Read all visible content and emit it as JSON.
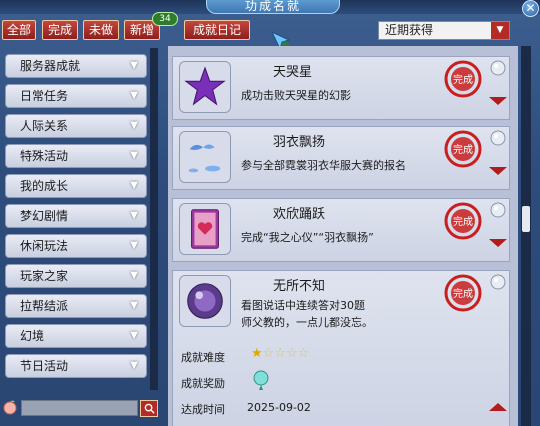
{
  "window": {
    "title": "功成名就",
    "close_glyph": "✕"
  },
  "filter_tabs": [
    {
      "label": "全部"
    },
    {
      "label": "完成"
    },
    {
      "label": "未做"
    },
    {
      "label": "新增",
      "badge": "34"
    }
  ],
  "diary_button": "成就日记",
  "sort_select": {
    "value": "近期获得"
  },
  "categories": [
    {
      "label": "服务器成就"
    },
    {
      "label": "日常任务"
    },
    {
      "label": "人际关系"
    },
    {
      "label": "特殊活动"
    },
    {
      "label": "我的成长"
    },
    {
      "label": "梦幻剧情"
    },
    {
      "label": "休闲玩法"
    },
    {
      "label": "玩家之家"
    },
    {
      "label": "拉帮结派"
    },
    {
      "label": "幻境"
    },
    {
      "label": "节日活动"
    }
  ],
  "search": {
    "placeholder": ""
  },
  "achievements": [
    {
      "name": "天哭星",
      "desc": "成功击败天哭星的幻影",
      "seal": "完成"
    },
    {
      "name": "羽衣飘扬",
      "desc": "参与全部霓裳羽衣华服大赛的报名",
      "seal": "完成"
    },
    {
      "name": "欢欣踊跃",
      "desc": "完成“我之心仪”“羽衣飘扬”",
      "seal": "完成"
    },
    {
      "name": "无所不知",
      "desc_line1": "看图说话中连续答对30题",
      "desc_line2": "师父教的，一点儿都没忘。",
      "seal": "完成",
      "difficulty_label": "成就难度",
      "difficulty_stars": 1,
      "difficulty_max": 5,
      "reward_label": "成就奖励",
      "date_label": "达成时间",
      "date": "2025-09-02"
    }
  ],
  "colors": {
    "accent_red": "#b21c1c",
    "star": "#e2a800",
    "badge_green": "#2d7d2a"
  }
}
